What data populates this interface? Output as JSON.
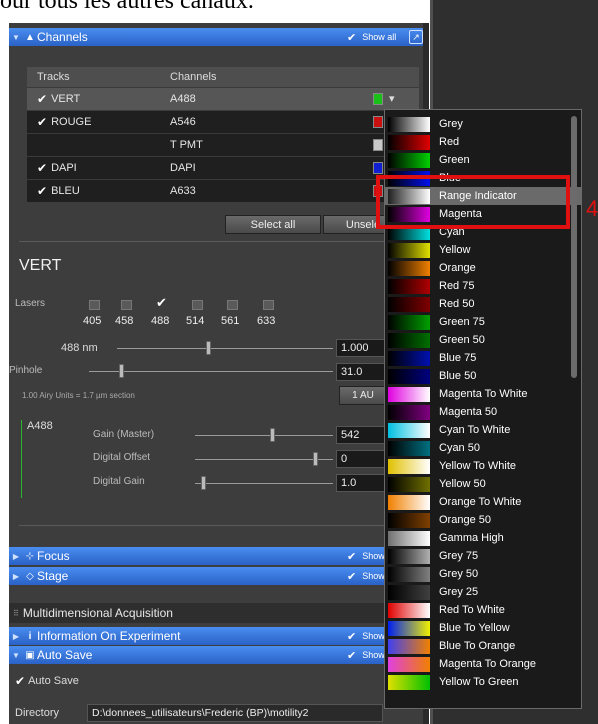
{
  "document_text": "our tous les autres canaux.",
  "channels_section": {
    "title": "Channels",
    "show_all": "Show all",
    "headers": {
      "tracks": "Tracks",
      "channels": "Channels"
    },
    "rows": [
      {
        "track": "VERT",
        "checked": true,
        "channel": "A488",
        "color": "#18c018",
        "selected": true
      },
      {
        "track": "ROUGE",
        "checked": true,
        "channel": "A546",
        "color": "#c81010"
      },
      {
        "track": "",
        "checked": false,
        "channel": "T PMT",
        "color": "#c8c8c8"
      },
      {
        "track": "DAPI",
        "checked": true,
        "channel": "DAPI",
        "color": "#1020d0"
      },
      {
        "track": "BLEU",
        "checked": true,
        "channel": "A633",
        "color": "#c81010"
      }
    ],
    "select_all": "Select all",
    "unselect": "Unsele"
  },
  "track_detail": {
    "name": "VERT",
    "lasers_label": "Lasers",
    "lasers": [
      {
        "wl": "405",
        "checked": false
      },
      {
        "wl": "458",
        "checked": false
      },
      {
        "wl": "488",
        "checked": true
      },
      {
        "wl": "514",
        "checked": false
      },
      {
        "wl": "561",
        "checked": false
      },
      {
        "wl": "633",
        "checked": false
      }
    ],
    "laser_line_label": "488 nm",
    "laser_power": "1.000",
    "pinhole_label": "Pinhole",
    "pinhole_value": "31.0",
    "airy_text": "1.00 Airy Units  =  1.7 µm section",
    "one_au": "1 AU",
    "channel_name": "A488",
    "gain_master_label": "Gain (Master)",
    "gain_master_value": "542",
    "digital_offset_label": "Digital Offset",
    "digital_offset_value": "0",
    "digital_gain_label": "Digital Gain",
    "digital_gain_value": "1.0"
  },
  "sections": {
    "focus": "Focus",
    "stage": "Stage",
    "show_short": "Show a",
    "multidim": "Multidimensional Acquisition",
    "info": "Information On Experiment",
    "autosave": "Auto Save",
    "autosave_check": "Auto Save",
    "directory_label": "Directory",
    "directory_value": "D:\\donnees_utilisateurs\\Frederic (BP)\\motility2"
  },
  "lut_menu": {
    "items": [
      {
        "label": "Grey",
        "from": "#000000",
        "to": "#ffffff"
      },
      {
        "label": "Red",
        "from": "#000000",
        "to": "#e00000"
      },
      {
        "label": "Green",
        "from": "#000000",
        "to": "#00d000"
      },
      {
        "label": "Blue",
        "from": "#000000",
        "to": "#0010f0"
      },
      {
        "label": "Range Indicator",
        "from": "#202020",
        "to": "#ffffff",
        "highlighted": true
      },
      {
        "label": "Magenta",
        "from": "#000000",
        "to": "#e000e0"
      },
      {
        "label": "Cyan",
        "from": "#000000",
        "to": "#00e0e0"
      },
      {
        "label": "Yellow",
        "from": "#000000",
        "to": "#e0e000"
      },
      {
        "label": "Orange",
        "from": "#000000",
        "to": "#f08000"
      },
      {
        "label": "Red 75",
        "from": "#000000",
        "to": "#b00000"
      },
      {
        "label": "Red 50",
        "from": "#000000",
        "to": "#800000"
      },
      {
        "label": "Green 75",
        "from": "#000000",
        "to": "#00a000"
      },
      {
        "label": "Green 50",
        "from": "#000000",
        "to": "#007000"
      },
      {
        "label": "Blue 75",
        "from": "#000000",
        "to": "#0010b0"
      },
      {
        "label": "Blue 50",
        "from": "#000000",
        "to": "#000080"
      },
      {
        "label": "Magenta To White",
        "from": "#e000e0",
        "to": "#ffffff"
      },
      {
        "label": "Magenta 50",
        "from": "#000000",
        "to": "#800080"
      },
      {
        "label": "Cyan To White",
        "from": "#00c0e0",
        "to": "#ffffff"
      },
      {
        "label": "Cyan 50",
        "from": "#000000",
        "to": "#007080"
      },
      {
        "label": "Yellow To White",
        "from": "#e0c000",
        "to": "#ffffff"
      },
      {
        "label": "Yellow 50",
        "from": "#000000",
        "to": "#707000"
      },
      {
        "label": "Orange To White",
        "from": "#f08000",
        "to": "#ffffff"
      },
      {
        "label": "Orange 50",
        "from": "#000000",
        "to": "#804000"
      },
      {
        "label": "Gamma High",
        "from": "#707070",
        "to": "#ffffff"
      },
      {
        "label": "Grey 75",
        "from": "#000000",
        "to": "#b0b0b0"
      },
      {
        "label": "Grey 50",
        "from": "#000000",
        "to": "#808080"
      },
      {
        "label": "Grey 25",
        "from": "#000000",
        "to": "#404040"
      },
      {
        "label": "Red To White",
        "from": "#e00000",
        "to": "#ffffff"
      },
      {
        "label": "Blue To Yellow",
        "from": "#0020f0",
        "to": "#f0f000"
      },
      {
        "label": "Blue To Orange",
        "from": "#4040f0",
        "to": "#f08000"
      },
      {
        "label": "Magenta To Orange",
        "from": "#e040e0",
        "to": "#f08000"
      },
      {
        "label": "Yellow To Green",
        "from": "#e0e000",
        "to": "#00c000"
      }
    ]
  },
  "annotation_mark": "4",
  "colors": {
    "accent": "#2a62c7",
    "highlight_border": "#e01010"
  }
}
